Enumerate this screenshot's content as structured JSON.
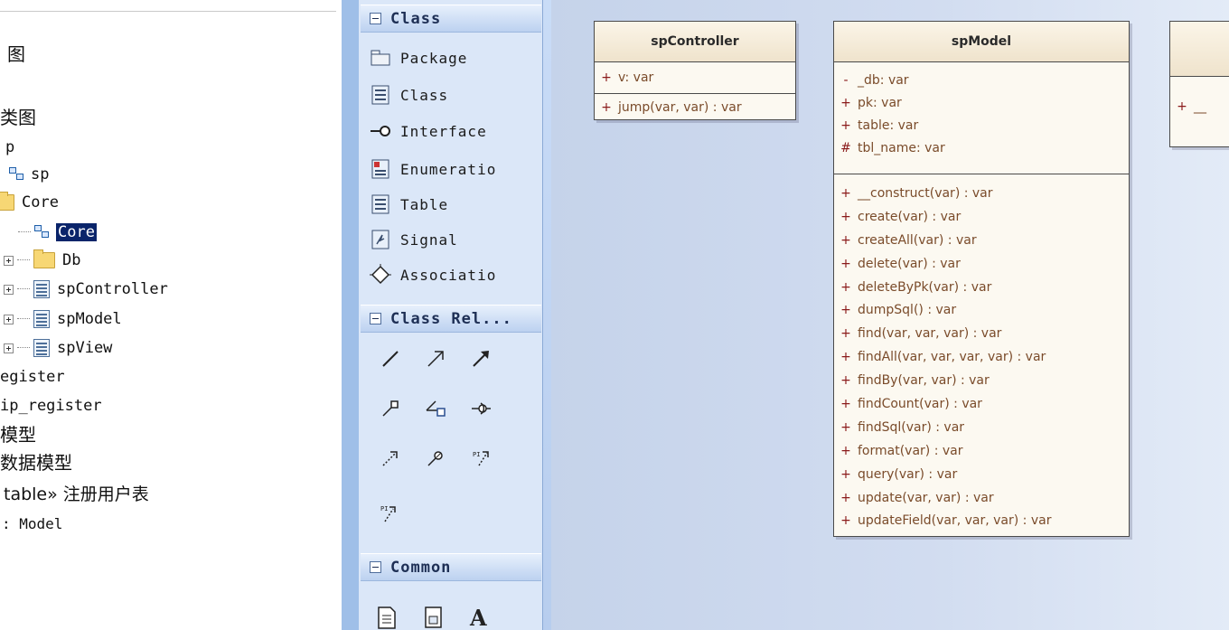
{
  "browser": {
    "items": [
      {
        "label": "图"
      },
      {
        "label": "类图"
      },
      {
        "label": "p"
      },
      {
        "label": "sp"
      },
      {
        "label": "Core"
      },
      {
        "label": "Core"
      },
      {
        "label": "Db"
      },
      {
        "label": "spController"
      },
      {
        "label": "spModel"
      },
      {
        "label": "spView"
      },
      {
        "label": "egister"
      },
      {
        "label": "ip_register"
      },
      {
        "label": "模型"
      },
      {
        "label": "数据模型"
      },
      {
        "label": "table» 注册用户表"
      },
      {
        "label": ": Model"
      }
    ]
  },
  "toolbox": {
    "sections": {
      "class": "Class",
      "class_rel": "Class Rel...",
      "common": "Common"
    },
    "class_items": [
      {
        "label": "Package",
        "icon": "package-icon"
      },
      {
        "label": "Class",
        "icon": "class-icon"
      },
      {
        "label": "Interface",
        "icon": "interface-icon"
      },
      {
        "label": "Enumeratio",
        "icon": "enumeration-icon"
      },
      {
        "label": "Table",
        "icon": "table-icon"
      },
      {
        "label": "Signal",
        "icon": "signal-icon"
      },
      {
        "label": "Associatio",
        "icon": "association-icon"
      }
    ],
    "relation_icons": [
      "association-line-icon",
      "directed-association-icon",
      "generalization-icon",
      "realization-icon",
      "aggregation-icon",
      "assembly-icon",
      "dependency-icon",
      "usage-icon",
      "trace-icon",
      "nesting-icon"
    ],
    "common_icons": [
      "note-icon",
      "text-document-icon",
      "text-label-icon"
    ]
  },
  "canvas": {
    "classes": [
      {
        "name": "spController",
        "attributes": [
          {
            "vis": "+",
            "text": "v:  var"
          }
        ],
        "operations": [
          {
            "vis": "+",
            "text": "jump(var, var) : var"
          }
        ]
      },
      {
        "name": "spModel",
        "attributes": [
          {
            "vis": "-",
            "text": "_db:  var"
          },
          {
            "vis": "+",
            "text": "pk:  var"
          },
          {
            "vis": "+",
            "text": "table:  var"
          },
          {
            "vis": "#",
            "text": "tbl_name:  var"
          }
        ],
        "operations": [
          {
            "vis": "+",
            "text": "__construct(var) : var"
          },
          {
            "vis": "+",
            "text": "create(var) : var"
          },
          {
            "vis": "+",
            "text": "createAll(var) : var"
          },
          {
            "vis": "+",
            "text": "delete(var) : var"
          },
          {
            "vis": "+",
            "text": "deleteByPk(var) : var"
          },
          {
            "vis": "+",
            "text": "dumpSql() : var"
          },
          {
            "vis": "+",
            "text": "find(var, var, var) : var"
          },
          {
            "vis": "+",
            "text": "findAll(var, var, var, var) : var"
          },
          {
            "vis": "+",
            "text": "findBy(var, var) : var"
          },
          {
            "vis": "+",
            "text": "findCount(var) : var"
          },
          {
            "vis": "+",
            "text": "findSql(var) : var"
          },
          {
            "vis": "+",
            "text": "format(var) : var"
          },
          {
            "vis": "+",
            "text": "query(var) : var"
          },
          {
            "vis": "+",
            "text": "update(var, var) : var"
          },
          {
            "vis": "+",
            "text": "updateField(var, var, var) : var"
          }
        ]
      },
      {
        "name": "",
        "attributes": [
          {
            "vis": "+",
            "text": "__"
          }
        ]
      }
    ]
  }
}
